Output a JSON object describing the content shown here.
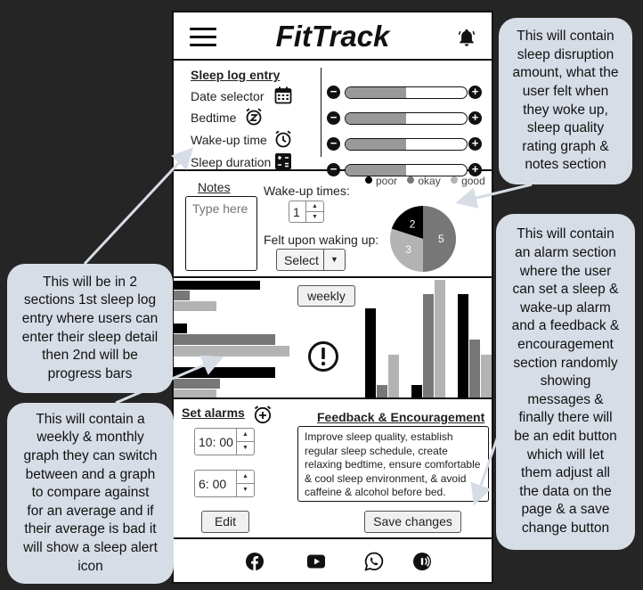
{
  "app": {
    "title": "FitTrack"
  },
  "sleep_log": {
    "title": "Sleep log entry",
    "rows": [
      "Date selector",
      "Bedtime",
      "Wake-up time",
      "Sleep duration"
    ],
    "progress": [
      0.5,
      0.5,
      0.5,
      0.5
    ]
  },
  "notes": {
    "label": "Notes",
    "placeholder": "Type here"
  },
  "wakeup": {
    "label": "Wake-up times:",
    "value": "1"
  },
  "felt": {
    "label": "Felt upon waking up:",
    "select": "Select"
  },
  "legend": [
    {
      "label": "poor",
      "color": "#000000"
    },
    {
      "label": "okay",
      "color": "#777777"
    },
    {
      "label": "good",
      "color": "#b3b3b3"
    }
  ],
  "pie": [
    {
      "label": "2",
      "value": 2,
      "color": "#000000"
    },
    {
      "label": "5",
      "value": 5,
      "color": "#777777"
    },
    {
      "label": "3",
      "value": 3,
      "color": "#b3b3b3"
    }
  ],
  "graph": {
    "toggle": "weekly"
  },
  "alarms": {
    "label": "Set alarms",
    "times": [
      "10: 00",
      "6: 00"
    ],
    "edit": "Edit"
  },
  "feedback": {
    "label": "Feedback & Encouragement",
    "text": "Improve sleep quality, establish regular sleep schedule, create relaxing bedtime, ensure comfortable & cool sleep environment, & avoid caffeine & alcohol before bed.",
    "save": "Save changes"
  },
  "footer": {
    "icons": [
      "facebook-icon",
      "youtube-icon",
      "whatsapp-icon",
      "podcast-icon"
    ]
  },
  "annotations": {
    "top_right": [
      "This will contain",
      "sleep disruption",
      "amount, what the",
      "user felt when",
      "they woke up,",
      "sleep quality",
      "rating graph &",
      "notes section"
    ],
    "mid_right": [
      "This will contain",
      "an alarm section",
      "where the user",
      "can set a sleep &",
      "wake-up alarm",
      "and a feedback &",
      "encouragement",
      "section randomly",
      "showing",
      "messages &",
      "finally there will",
      "be an edit button",
      "which will let",
      "them adjust all",
      "the data on the",
      "page & a save",
      "change button"
    ],
    "left_top": [
      "This will be in 2",
      "sections 1st sleep log",
      "entry where users can",
      "enter their sleep detail",
      "then 2nd will be",
      "progress bars"
    ],
    "left_bottom": [
      "This will contain a",
      "weekly & monthly",
      "graph they can switch",
      "between and a graph",
      "to compare against",
      "for an average and if",
      "their average is bad it",
      "will show a sleep alert",
      "icon"
    ]
  }
}
